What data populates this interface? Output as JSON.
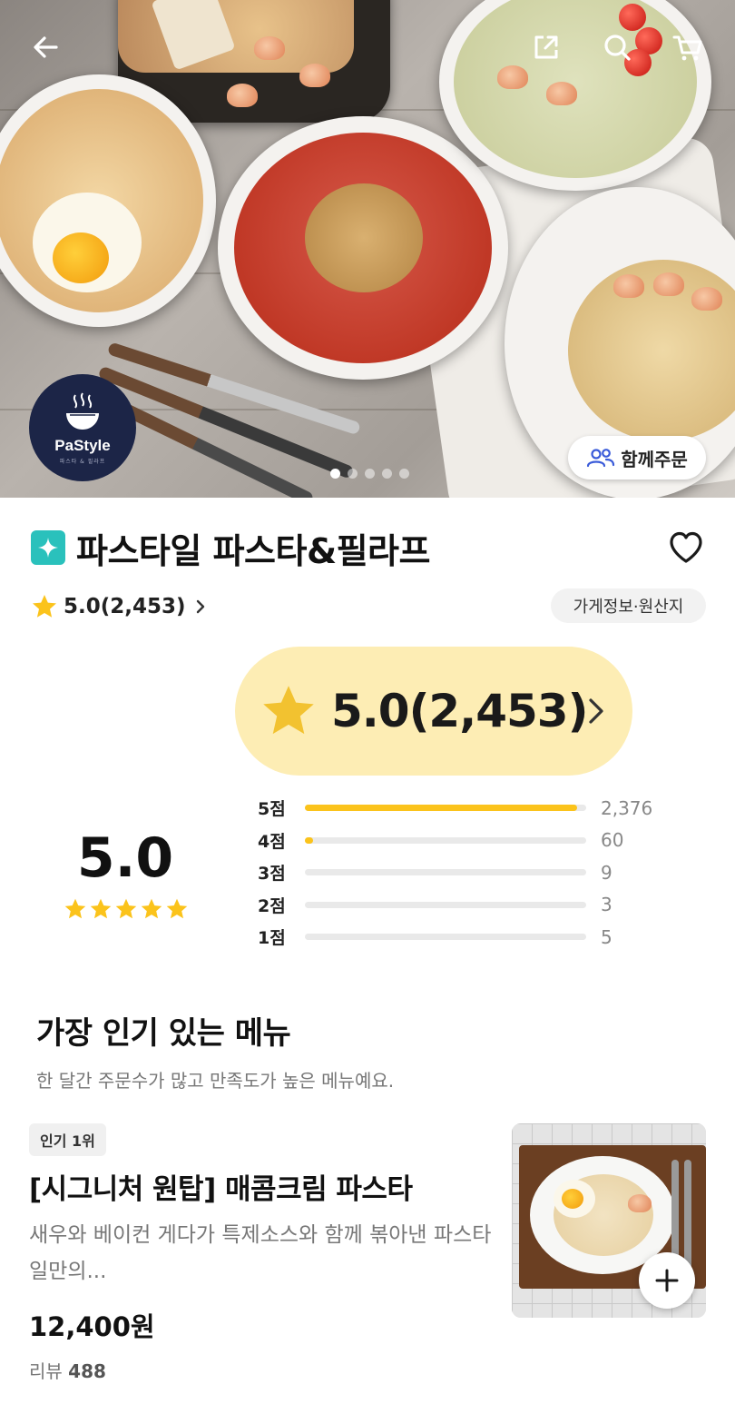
{
  "hero": {
    "logo_text": "PaStyle",
    "logo_sub": "파스타 & 필라프",
    "group_order_label": "함께주문",
    "slides_total": 5,
    "active_slide": 1
  },
  "store": {
    "name": "파스타일 파스타&필라프",
    "rating_summary": "5.0(2,453)",
    "info_button": "가게정보·원산지"
  },
  "rating": {
    "pill_text": "5.0(2,453)",
    "score": "5.0",
    "stars": 5,
    "distribution": [
      {
        "label": "5점",
        "count": "2,376",
        "value": 2376
      },
      {
        "label": "4점",
        "count": "60",
        "value": 60
      },
      {
        "label": "3점",
        "count": "9",
        "value": 9
      },
      {
        "label": "2점",
        "count": "3",
        "value": 3
      },
      {
        "label": "1점",
        "count": "5",
        "value": 5
      }
    ],
    "total": 2453
  },
  "popular": {
    "title": "가장 인기 있는 메뉴",
    "subtitle": "한 달간 주문수가 많고 만족도가 높은 메뉴예요.",
    "item": {
      "rank_badge": "인기 1위",
      "name": "[시그니처 원탑] 매콤크림 파스타",
      "description": "새우와 베이컨 게다가 특제소스와 함께 볶아낸 파스타일만의...",
      "price": "12,400원",
      "review_label": "리뷰",
      "review_count": "488"
    }
  },
  "colors": {
    "accent_yellow": "#fbc31b",
    "pill_bg": "#fdedb4",
    "mint_badge": "#2ac1bc",
    "logo_navy": "#1c2547"
  },
  "icons": {
    "back": "arrow-left-icon",
    "share": "share-icon",
    "search": "search-icon",
    "cart": "cart-icon",
    "heart": "heart-icon",
    "star": "star-icon",
    "group": "people-icon",
    "chevron": "chevron-right-icon",
    "add": "plus-icon"
  }
}
